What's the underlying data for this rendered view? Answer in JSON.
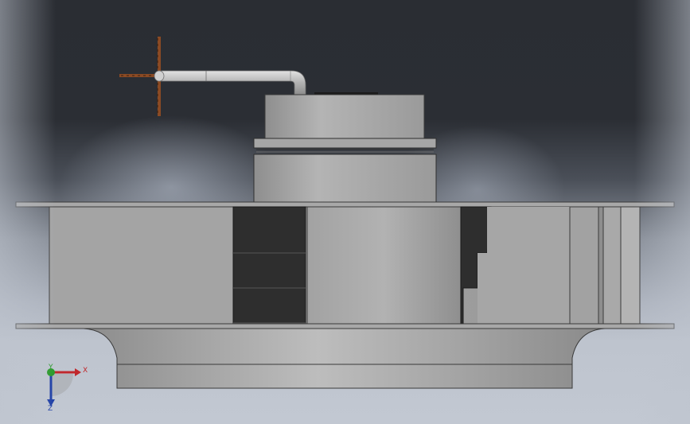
{
  "viewport": {
    "background": "graphics-area-gradient",
    "model": {
      "name": "centrifugal-fan-assembly",
      "view": "front",
      "pipe_color": "#b2b2b2",
      "crossbar_color": "#8a4a24",
      "body_color": "#a8a8a8",
      "dark_blade_color": "#2e2e2e"
    },
    "triad": {
      "x_label": "X",
      "y_label": "Y",
      "z_label": "Z",
      "x_color": "#c0282c",
      "y_color": "#2a9a2a",
      "z_color": "#1f3fa6"
    }
  }
}
